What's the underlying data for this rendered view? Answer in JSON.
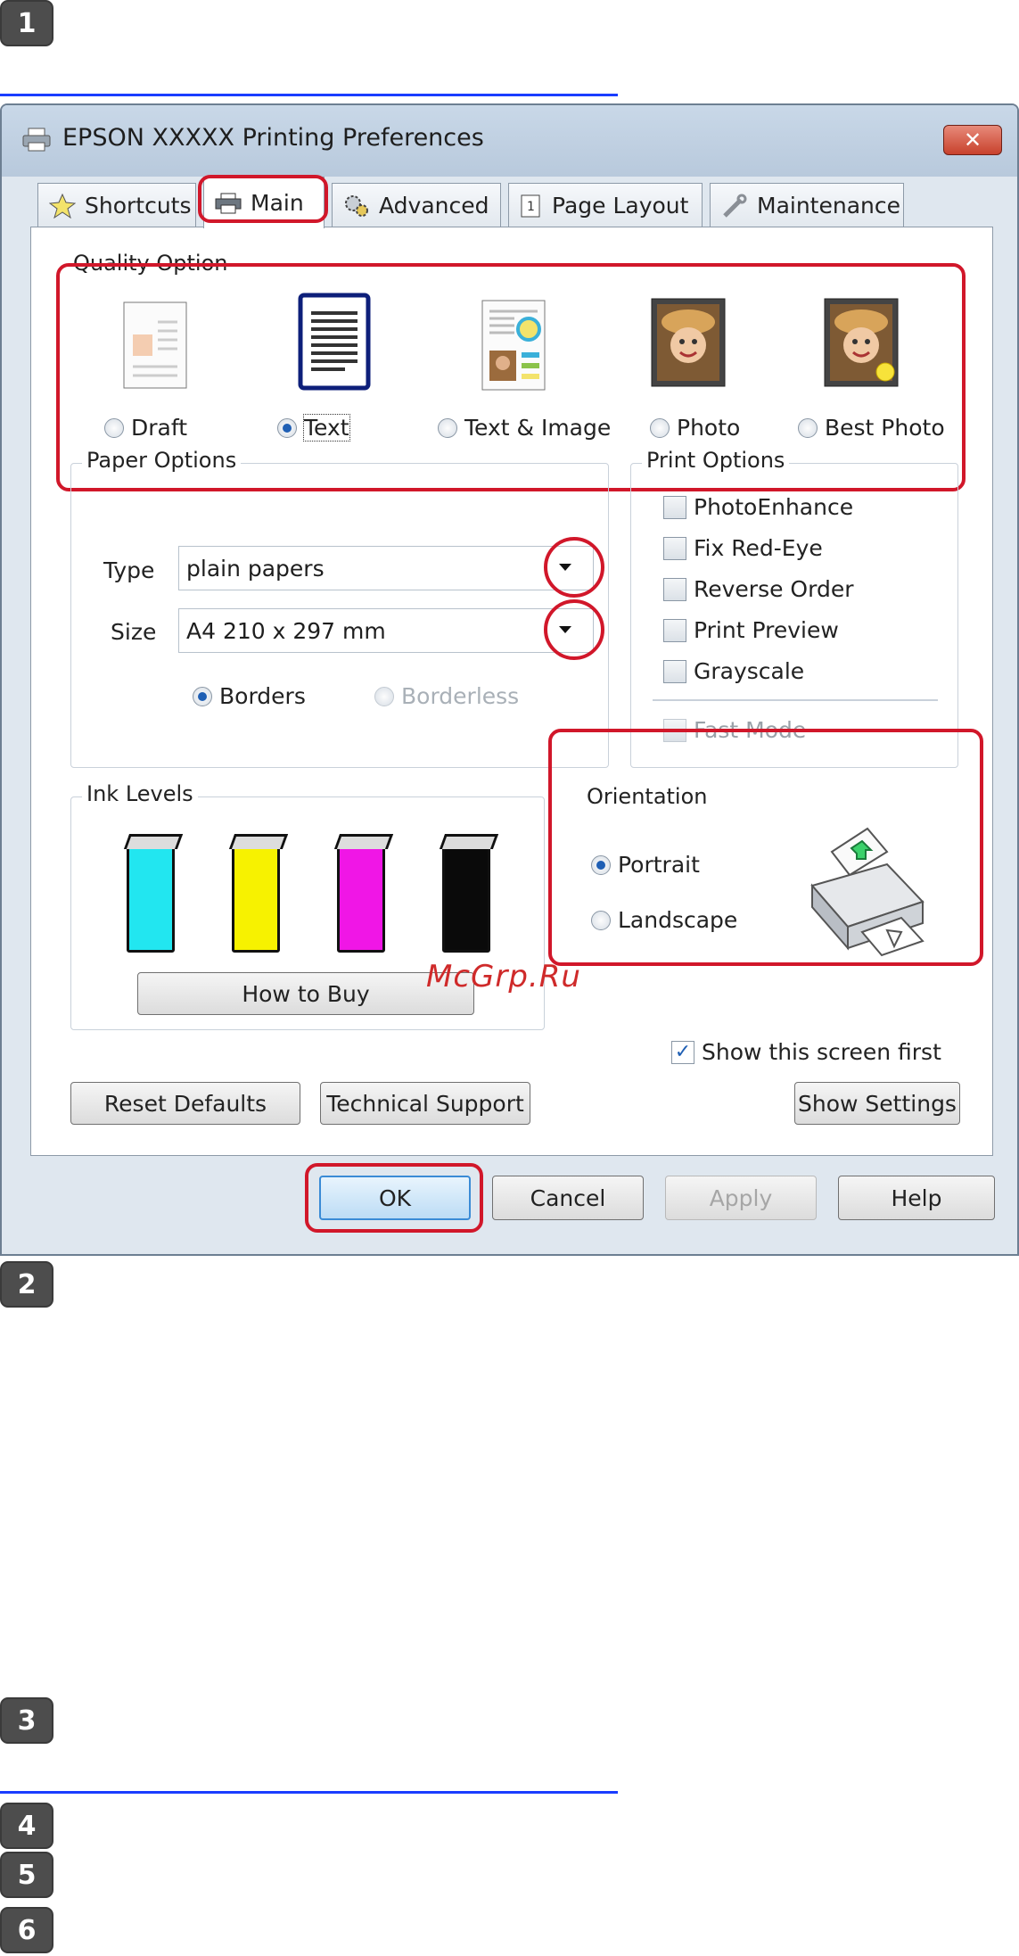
{
  "steps": [
    "1",
    "2",
    "3",
    "4",
    "5",
    "6"
  ],
  "watermark": "McGrp.Ru",
  "dialog": {
    "title": "EPSON XXXXX   Printing Preferences",
    "close_label": "✕",
    "tabs": [
      "Shortcuts",
      "Main",
      "Advanced",
      "Page Layout",
      "Maintenance"
    ],
    "active_tab": "Main",
    "quality": {
      "label": "Quality Option",
      "options": [
        "Draft",
        "Text",
        "Text & Image",
        "Photo",
        "Best Photo"
      ],
      "selected": "Text"
    },
    "paper": {
      "label": "Paper Options",
      "type_label": "Type",
      "type_value": "plain papers",
      "size_label": "Size",
      "size_value": "A4 210 x 297 mm",
      "borders_label": "Borders",
      "borderless_label": "Borderless",
      "selected": "Borders"
    },
    "print_options": {
      "label": "Print Options",
      "items": [
        "PhotoEnhance",
        "Fix Red-Eye",
        "Reverse Order",
        "Print Preview",
        "Grayscale"
      ],
      "fast_mode": "Fast Mode"
    },
    "ink": {
      "label": "Ink Levels",
      "colors": [
        "#22e6f0",
        "#f7f200",
        "#f016e6",
        "#0a0a0a"
      ],
      "how_to_buy": "How to Buy"
    },
    "orientation": {
      "label": "Orientation",
      "portrait": "Portrait",
      "landscape": "Landscape",
      "selected": "Portrait"
    },
    "show_screen_first": "Show this screen first",
    "show_screen_first_checked": true,
    "buttons": {
      "reset": "Reset Defaults",
      "support": "Technical Support",
      "show_settings": "Show Settings",
      "ok": "OK",
      "cancel": "Cancel",
      "apply": "Apply",
      "help": "Help"
    },
    "highlight_color": "#d1172a"
  }
}
